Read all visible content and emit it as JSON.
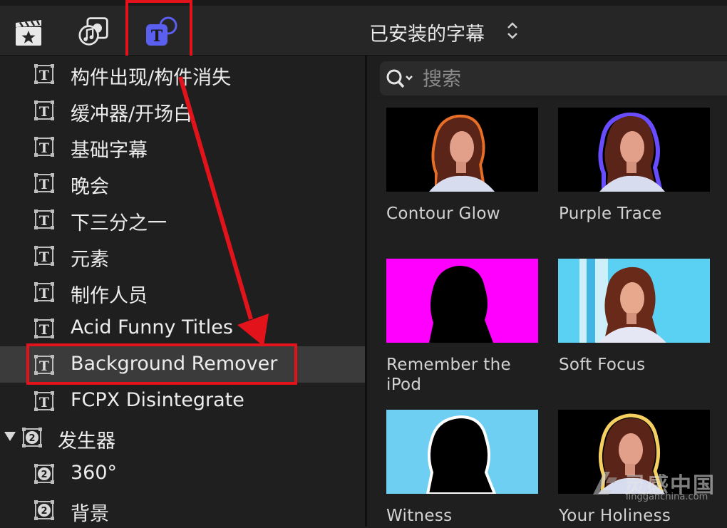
{
  "browser": {
    "title": "已安装的字幕"
  },
  "search": {
    "placeholder": "搜索",
    "value": ""
  },
  "sidebar": {
    "items": [
      {
        "label": "构件出现/构件消失",
        "icon": "title-icon"
      },
      {
        "label": "缓冲器/开场白",
        "icon": "title-icon"
      },
      {
        "label": "基础字幕",
        "icon": "title-icon"
      },
      {
        "label": "晚会",
        "icon": "title-icon"
      },
      {
        "label": "下三分之一",
        "icon": "title-icon"
      },
      {
        "label": "元素",
        "icon": "title-icon"
      },
      {
        "label": "制作人员",
        "icon": "title-icon"
      },
      {
        "label": "Acid Funny Titles",
        "icon": "title-icon"
      },
      {
        "label": "Background Remover",
        "icon": "title-icon",
        "selected": true
      },
      {
        "label": "FCPX Disintegrate",
        "icon": "title-icon"
      }
    ],
    "generators": {
      "label": "发生器",
      "icon": "generator-icon",
      "items": [
        {
          "label": "360°",
          "icon": "generator-icon"
        },
        {
          "label": "背景",
          "icon": "generator-icon"
        }
      ]
    }
  },
  "thumbnails": [
    {
      "label": "Contour Glow"
    },
    {
      "label": "Purple Trace"
    },
    {
      "label": "Remember the iPod"
    },
    {
      "label": "Soft Focus"
    },
    {
      "label": "Witness"
    },
    {
      "label": "Your Holiness"
    }
  ],
  "watermark": {
    "text": "灵感中国",
    "sub": "lingganchina.com"
  },
  "colors": {
    "annotation": "#e3131b",
    "accent": "#5a5ff0",
    "magenta": "#ff00ff",
    "cyan": "#55ccf0"
  }
}
